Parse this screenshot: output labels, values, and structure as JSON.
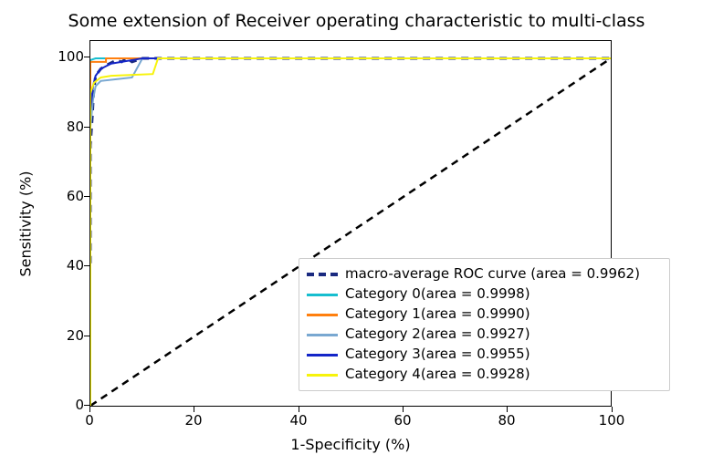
{
  "chart_data": {
    "type": "line",
    "title": "Some extension of Receiver operating characteristic to multi-class",
    "xlabel": "1-Specificity (%)",
    "ylabel": "Sensitivity (%)",
    "xlim": [
      0,
      100
    ],
    "ylim": [
      0,
      105
    ],
    "xticks": [
      0,
      20,
      40,
      60,
      80,
      100
    ],
    "yticks": [
      0,
      20,
      40,
      60,
      80,
      100
    ],
    "reference_line": {
      "name": "chance diagonal",
      "from": [
        0,
        0
      ],
      "to": [
        100,
        100
      ],
      "style": "dashed",
      "color": "#000000"
    },
    "series": [
      {
        "name": "macro-average ROC curve (area = 0.9962)",
        "style": "dashed",
        "color": "#1a2a80",
        "width": 3,
        "points": [
          [
            0,
            41
          ],
          [
            0,
            75
          ],
          [
            0.4,
            84
          ],
          [
            0.6,
            90
          ],
          [
            1.0,
            95
          ],
          [
            2.0,
            97
          ],
          [
            3.0,
            98
          ],
          [
            5.0,
            99.5
          ],
          [
            6.0,
            99
          ],
          [
            7.0,
            100
          ],
          [
            8.0,
            99
          ],
          [
            10.0,
            100
          ],
          [
            100,
            100
          ]
        ]
      },
      {
        "name": "Category 0(area = 0.9998)",
        "style": "solid",
        "color": "#17becf",
        "width": 2,
        "points": [
          [
            0,
            0
          ],
          [
            0,
            99.5
          ],
          [
            1.0,
            100
          ],
          [
            100,
            100
          ]
        ]
      },
      {
        "name": "Category 1(area = 0.9990)",
        "style": "solid",
        "color": "#ff7f0e",
        "width": 2,
        "points": [
          [
            0,
            0
          ],
          [
            0,
            99.0
          ],
          [
            3.0,
            99.0
          ],
          [
            3.0,
            100
          ],
          [
            100,
            100
          ]
        ]
      },
      {
        "name": "Category 2(area = 0.9927)",
        "style": "solid",
        "color": "#79a8d1",
        "width": 2,
        "points": [
          [
            0,
            0
          ],
          [
            0,
            80
          ],
          [
            0.5,
            88
          ],
          [
            1.0,
            92
          ],
          [
            2.0,
            93.5
          ],
          [
            5.0,
            94
          ],
          [
            8.0,
            94.5
          ],
          [
            10.0,
            100
          ],
          [
            100,
            100
          ]
        ]
      },
      {
        "name": "Category 3(area = 0.9955)",
        "style": "solid",
        "color": "#1325c8",
        "width": 2,
        "points": [
          [
            0,
            0
          ],
          [
            0,
            85
          ],
          [
            0.5,
            92
          ],
          [
            1.0,
            95
          ],
          [
            2.0,
            97
          ],
          [
            4.0,
            98.5
          ],
          [
            6.0,
            99
          ],
          [
            8.0,
            99.5
          ],
          [
            10.0,
            100
          ],
          [
            100,
            100
          ]
        ]
      },
      {
        "name": "Category 4(area = 0.9928)",
        "style": "solid",
        "color": "#f7f30b",
        "width": 2,
        "points": [
          [
            0,
            0
          ],
          [
            0,
            90
          ],
          [
            0.7,
            93
          ],
          [
            2.0,
            94.5
          ],
          [
            4.0,
            95
          ],
          [
            12.0,
            95.5
          ],
          [
            13.0,
            100
          ],
          [
            100,
            100
          ]
        ]
      }
    ],
    "legend": {
      "position": "lower-center-right",
      "entries": [
        "macro-average ROC curve (area = 0.9962)",
        "Category 0(area = 0.9998)",
        "Category 1(area = 0.9990)",
        "Category 2(area = 0.9927)",
        "Category 3(area = 0.9955)",
        "Category 4(area = 0.9928)"
      ]
    }
  },
  "colors": {
    "macro": "#1a2a80",
    "cat0": "#17becf",
    "cat1": "#ff7f0e",
    "cat2": "#79a8d1",
    "cat3": "#1325c8",
    "cat4": "#f7f30b",
    "diag": "#000000"
  },
  "ticks": {
    "x": [
      "0",
      "20",
      "40",
      "60",
      "80",
      "100"
    ],
    "y": [
      "0",
      "20",
      "40",
      "60",
      "80",
      "100"
    ]
  }
}
